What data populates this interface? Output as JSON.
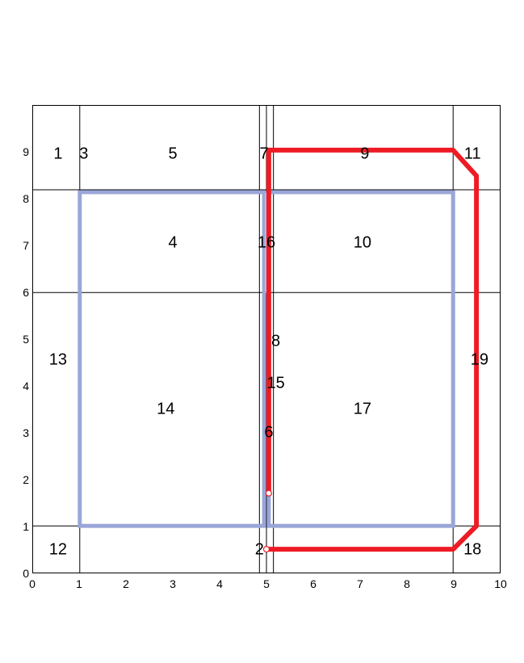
{
  "chart_data": {
    "type": "line",
    "title": "",
    "xlabel": "",
    "ylabel": "",
    "xlim": [
      0,
      10
    ],
    "ylim": [
      0,
      10
    ],
    "xticks": [
      0,
      1,
      2,
      3,
      4,
      5,
      6,
      7,
      8,
      9,
      10
    ],
    "yticks": [
      0,
      1,
      2,
      3,
      4,
      5,
      6,
      7,
      8,
      9
    ],
    "grid_lines": {
      "vertical_black": [
        1.0,
        4.85,
        5.0,
        5.15,
        9.0
      ],
      "horizontal_black": [
        1.0,
        6.0,
        8.2
      ]
    },
    "blue_rects": [
      {
        "x1": 1.0,
        "y1": 1.0,
        "x2": 4.95,
        "y2": 8.15
      },
      {
        "x1": 5.05,
        "y1": 1.0,
        "x2": 9.0,
        "y2": 8.15
      }
    ],
    "blue_narrow_rect": {
      "x1": 4.95,
      "y1": 6.0,
      "x2": 5.05,
      "y2": 8.15
    },
    "red_path": [
      [
        5.05,
        1.7
      ],
      [
        5.05,
        9.05
      ],
      [
        9.0,
        9.05
      ],
      [
        9.5,
        8.5
      ],
      [
        9.5,
        1.0
      ],
      [
        9.0,
        0.5
      ],
      [
        5.0,
        0.5
      ]
    ],
    "red_markers": [
      [
        5.05,
        1.7
      ],
      [
        5.0,
        0.5
      ]
    ],
    "region_labels": [
      {
        "n": "1",
        "x": 0.55,
        "y": 8.95
      },
      {
        "n": "3",
        "x": 1.1,
        "y": 8.95
      },
      {
        "n": "5",
        "x": 3.0,
        "y": 8.95
      },
      {
        "n": "7",
        "x": 4.95,
        "y": 8.95
      },
      {
        "n": "9",
        "x": 7.1,
        "y": 8.95
      },
      {
        "n": "11",
        "x": 9.4,
        "y": 8.95
      },
      {
        "n": "4",
        "x": 3.0,
        "y": 7.05
      },
      {
        "n": "16",
        "x": 5.0,
        "y": 7.05
      },
      {
        "n": "10",
        "x": 7.05,
        "y": 7.05
      },
      {
        "n": "8",
        "x": 5.2,
        "y": 4.95
      },
      {
        "n": "13",
        "x": 0.55,
        "y": 4.55
      },
      {
        "n": "15",
        "x": 5.2,
        "y": 4.05
      },
      {
        "n": "14",
        "x": 2.85,
        "y": 3.5
      },
      {
        "n": "17",
        "x": 7.05,
        "y": 3.5
      },
      {
        "n": "19",
        "x": 9.55,
        "y": 4.55
      },
      {
        "n": "6",
        "x": 5.05,
        "y": 3.0
      },
      {
        "n": "12",
        "x": 0.55,
        "y": 0.5
      },
      {
        "n": "2",
        "x": 4.85,
        "y": 0.5
      },
      {
        "n": "18",
        "x": 9.4,
        "y": 0.5
      }
    ],
    "colors": {
      "grid": "#000000",
      "blue_rect_stroke": "#9aa6d8",
      "blue_fill": "#b6c0e4",
      "red": "#ed1c24"
    }
  }
}
